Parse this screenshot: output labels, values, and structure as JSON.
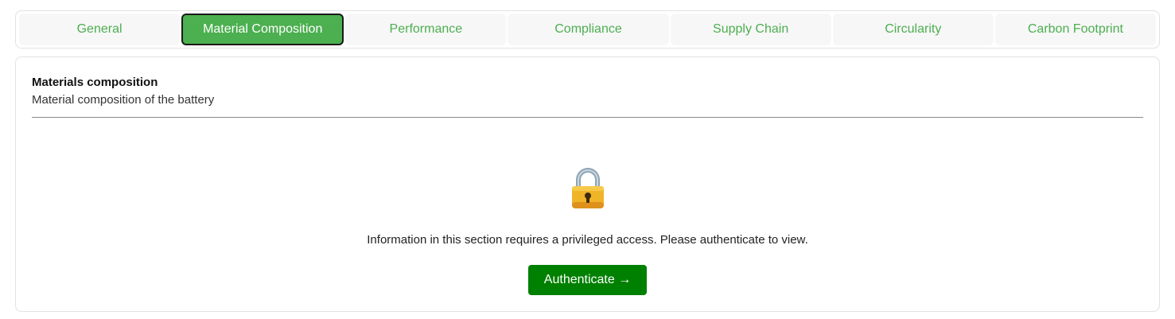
{
  "tabs": [
    {
      "label": "General",
      "active": false
    },
    {
      "label": "Material Composition",
      "active": true
    },
    {
      "label": "Performance",
      "active": false
    },
    {
      "label": "Compliance",
      "active": false
    },
    {
      "label": "Supply Chain",
      "active": false
    },
    {
      "label": "Circularity",
      "active": false
    },
    {
      "label": "Carbon Footprint",
      "active": false
    }
  ],
  "section": {
    "title": "Materials composition",
    "subtitle": "Material composition of the battery"
  },
  "locked": {
    "icon": "lock-icon",
    "message": "Information in this section requires a privileged access. Please authenticate to view.",
    "button_label": "Authenticate →"
  },
  "colors": {
    "accent": "#4caf50",
    "button": "#008000"
  }
}
